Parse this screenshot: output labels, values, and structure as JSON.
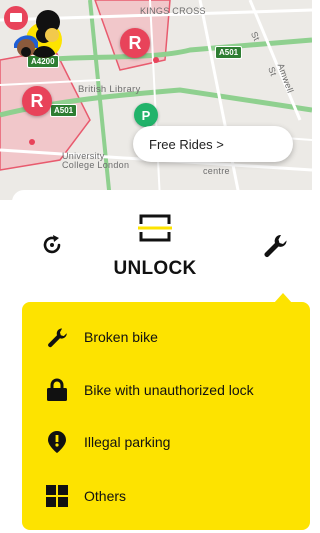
{
  "map": {
    "labels": {
      "kings_cross": "KINGS CROSS",
      "british_library": "British Library",
      "university": "University",
      "college_london": "College London",
      "centre": "centre",
      "amwell": "Amwell St",
      "street_partial": "St"
    },
    "shields": {
      "a4200": "A4200",
      "a501_top": "A501",
      "a501_left": "A501"
    },
    "markers": {
      "no_parking_1": "R",
      "no_parking_2": "R",
      "parking": "P"
    }
  },
  "promo": {
    "label": "Free Rides >"
  },
  "actions": {
    "unlock_label": "UNLOCK"
  },
  "report_menu": {
    "items": [
      {
        "label": "Broken bike",
        "icon": "wrench-icon"
      },
      {
        "label": "Bike with unauthorized lock",
        "icon": "lock-icon"
      },
      {
        "label": "Illegal parking",
        "icon": "alert-icon"
      },
      {
        "label": "Others",
        "icon": "grid-icon"
      }
    ]
  },
  "colors": {
    "accent": "#fde300",
    "marker_red": "#e8435a",
    "marker_green": "#21b36a"
  }
}
